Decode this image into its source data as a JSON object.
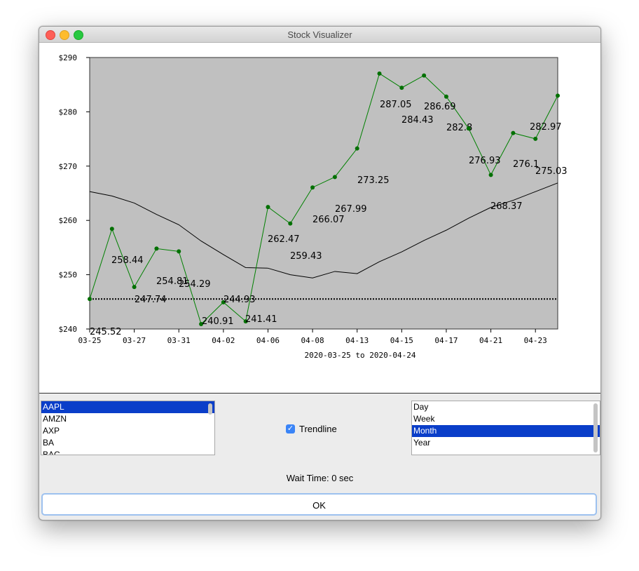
{
  "window": {
    "title": "Stock Visualizer"
  },
  "colors": {
    "plot_bg": "#c0c0c0",
    "price_line": "#008000",
    "trend_line": "#000000",
    "selection": "#0a3ec9"
  },
  "chart_data": {
    "type": "line",
    "xlabel": "2020-03-25 to 2020-04-24",
    "ylim": [
      240,
      290
    ],
    "y_ticks": [
      "$240",
      "$250",
      "$260",
      "$270",
      "$280",
      "$290"
    ],
    "x_ticks": [
      "03-25",
      "03-27",
      "03-31",
      "04-02",
      "04-06",
      "04-08",
      "04-13",
      "04-15",
      "04-17",
      "04-21",
      "04-23"
    ],
    "reference_line": 245.52,
    "series": [
      {
        "values": [
          245.52,
          258.44,
          247.74,
          254.81,
          254.29,
          240.91,
          244.93,
          241.41,
          262.47,
          259.43,
          266.07,
          267.99,
          273.25,
          287.05,
          284.43,
          286.69,
          282.8,
          276.93,
          268.37,
          276.1,
          275.03,
          282.97
        ],
        "labels": [
          "245.52",
          "258.44",
          "247.74",
          "254.81",
          "254.29",
          "240.91",
          "244.93",
          "241.41",
          "262.47",
          "259.43",
          "266.07",
          "267.99",
          "273.25",
          "287.05",
          "284.43",
          "286.69",
          "282.8",
          "276.93",
          "268.37",
          "276.1",
          "275.03",
          "282.97"
        ]
      },
      {
        "values": [
          265.3,
          264.5,
          263.2,
          261.1,
          259.2,
          256.2,
          253.7,
          251.3,
          251.2,
          250.0,
          249.4,
          250.6,
          250.2,
          252.4,
          254.2,
          256.3,
          258.2,
          260.4,
          262.4,
          263.7,
          265.3,
          266.9
        ]
      }
    ]
  },
  "stocks": {
    "items": [
      "AAPL",
      "AMZN",
      "AXP",
      "BA",
      "BAC"
    ],
    "selected": "AAPL"
  },
  "trendline": {
    "label": "Trendline",
    "checked": true
  },
  "periods": {
    "items": [
      "Day",
      "Week",
      "Month",
      "Year"
    ],
    "selected": "Month"
  },
  "wait_time": "Wait Time: 0 sec",
  "ok_button": {
    "label": "OK"
  }
}
